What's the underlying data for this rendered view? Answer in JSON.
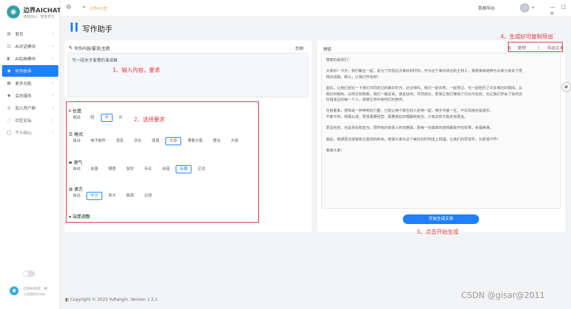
{
  "app": {
    "name": "边界AICHAT",
    "tagline": "高效办公，智慧学习"
  },
  "sidebar": {
    "items": [
      {
        "label": "首页",
        "icon": "home-icon",
        "glyph": "▤",
        "chevron": "›"
      },
      {
        "label": "AI对话模块",
        "icon": "chat-icon",
        "glyph": "◫",
        "chevron": "›"
      },
      {
        "label": "AI绘画模块",
        "icon": "paint-icon",
        "glyph": "◧",
        "chevron": "›"
      },
      {
        "label": "写作助手",
        "icon": "pen-icon",
        "glyph": "◉",
        "chevron": "",
        "active": true
      },
      {
        "label": "更多功能",
        "icon": "grid-icon",
        "glyph": "▦",
        "chevron": "›"
      },
      {
        "label": "会员服务",
        "icon": "vip-icon",
        "glyph": "◆",
        "chevron": "›"
      },
      {
        "label": "加入用户群",
        "icon": "group-icon",
        "glyph": "◎",
        "chevron": "›"
      },
      {
        "label": "社区论坛",
        "icon": "forum-icon",
        "glyph": "◌",
        "chevron": "›"
      },
      {
        "label": "个人中心",
        "icon": "user-icon",
        "glyph": "◯",
        "chevron": "›"
      }
    ],
    "footer_line1": "边界AI科技，用",
    "footer_line2": "心创造AIChat"
  },
  "topbar": {
    "notice": "边界AI公告",
    "right_text": "数据导出",
    "window_controls": "— ☐ ✕"
  },
  "page": {
    "title": "写作助手"
  },
  "editor": {
    "heading": "写作内容/要求/主题",
    "example_label": "示例",
    "input_value": "写一段关于爱情的演讲稿"
  },
  "options": {
    "length": {
      "title": "长度",
      "items": [
        {
          "label": "自动"
        },
        {
          "label": "短"
        },
        {
          "label": "中",
          "selected": true
        },
        {
          "label": "长"
        }
      ]
    },
    "format": {
      "title": "格式",
      "items": [
        {
          "label": "自动"
        },
        {
          "label": "电子邮件"
        },
        {
          "label": "消息"
        },
        {
          "label": "评论"
        },
        {
          "label": "段落"
        },
        {
          "label": "文章",
          "selected": true
        },
        {
          "label": "博客文章"
        },
        {
          "label": "想法"
        },
        {
          "label": "大纲"
        }
      ]
    },
    "tone": {
      "title": "语气",
      "items": [
        {
          "label": "自动"
        },
        {
          "label": "友善"
        },
        {
          "label": "随意"
        },
        {
          "label": "友好"
        },
        {
          "label": "专业"
        },
        {
          "label": "诙谐"
        },
        {
          "label": "有趣",
          "selected": true
        },
        {
          "label": "正式"
        }
      ]
    },
    "language": {
      "title": "语言",
      "items": [
        {
          "label": "自动"
        },
        {
          "label": "中文",
          "selected": true
        },
        {
          "label": "英文"
        },
        {
          "label": "韩语"
        },
        {
          "label": "日语"
        }
      ]
    },
    "deep_label": "深度调整"
  },
  "preview": {
    "heading": "预览",
    "copy_label": "复制",
    "export_label": "导出文本",
    "paragraphs": [
      [
        "尊敬的嘉宾们："
      ],
      [
        "大家好！今天，我们聚在一起，是为了庆祝这次美好的时刻，作为这个美妙场合的主持人，我很荣幸能够与大家分享关于爱",
        "情的话题。那么，让我们开始吧！"
      ],
      [
        "首先，让我们回忆一下我们共同走过的美好时光。还记得吗，我们一起欢笑，一起哭泣，也一起经历了许多难忘的瞬间。从",
        "相识到相知，从陌生到熟悉，我们一路走来，彼此扶持，共同成长。爱情让我们懂得了付出与包容，也让我们学会了如何去",
        "珍惜身边的每一个人，感谢生命中有你们的陪伴。"
      ],
      [
        "在我看来，爱情是一种神奇的力量，它能让两个陌生的人走到一起，携手共度一生，不论风雨还是晴天，",
        "不离不弃，相濡以沫。爱情需要经营，需要彼此的理解和信任，只有这样才能走得更远。"
      ],
      [
        "爱是包容，也是责任和担当。愿所有的有情人终成眷属，愿每一份真挚的感情都能开花结果，幸福美满。"
      ],
      [
        "最后，我想再次感谢各位嘉宾的到来，感谢大家为这个美好的时刻送上祝福。让我们共同举杯，为爱情干杯！"
      ],
      [
        "谢谢大家！"
      ]
    ],
    "generate_label": "开始生成文章"
  },
  "annotations": {
    "a1": "1、输入内容，要求",
    "a2": "2、选择要求",
    "a3": "3、点击开始生成",
    "a4": "4、生成好可复制导出"
  },
  "footer": {
    "copyright": "Copyright © 2023 YuRangin. Version 1.3.1"
  },
  "watermark": "CSDN @gisar@2011",
  "colors": {
    "accent": "#1e80ff",
    "annotation": "#e8323c"
  }
}
